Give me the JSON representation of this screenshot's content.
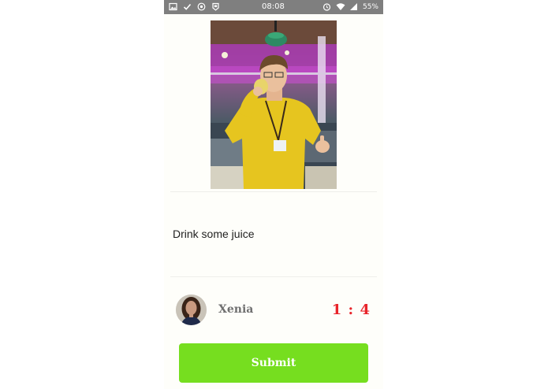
{
  "status_bar": {
    "time": "08:08",
    "battery": "55%",
    "left_icons": [
      "image-icon",
      "check-icon",
      "shield-icon",
      "app-icon"
    ],
    "right_icons": [
      "alarm-icon",
      "wifi-icon",
      "signal-icon"
    ]
  },
  "task": {
    "text": "Drink some juice"
  },
  "player": {
    "name": "Xenia",
    "score": "1 : 4"
  },
  "submit_label": "Submit",
  "colors": {
    "accent": "#76de1f",
    "score": "#e8242a",
    "status_bar": "#7f7f7f"
  }
}
